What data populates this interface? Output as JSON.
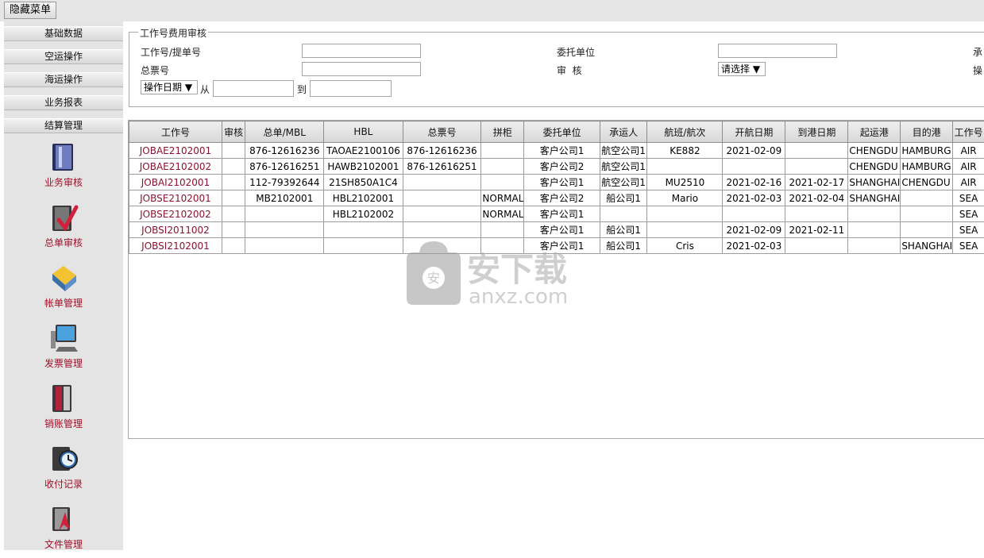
{
  "topbar": {
    "hide_menu_button": "隐藏菜单"
  },
  "sidebar": {
    "groups": [
      "基础数据",
      "空运操作",
      "海运操作",
      "业务报表",
      "结算管理"
    ],
    "items": [
      {
        "label": "业务审核",
        "icon": "book-icon"
      },
      {
        "label": "总单审核",
        "icon": "book-check-icon"
      },
      {
        "label": "帐单管理",
        "icon": "folder-icon"
      },
      {
        "label": "发票管理",
        "icon": "computer-icon"
      },
      {
        "label": "销账管理",
        "icon": "binder-icon"
      },
      {
        "label": "收付记录",
        "icon": "clock-icon"
      },
      {
        "label": "文件管理",
        "icon": "document-icon"
      }
    ]
  },
  "filter": {
    "legend": "工作号费用审核",
    "job_no_label": "工作号/提单号",
    "job_no_value": "",
    "client_label": "委托单位",
    "client_value": "",
    "carrier_label_partial": "承",
    "master_no_label": "总票号",
    "master_no_value": "",
    "audit_label": "审  核",
    "audit_select": "请选择 ▼",
    "operator_label_partial": "操",
    "date_type_select": "操作日期 ▼",
    "from_label": "从",
    "from_value": "",
    "to_label": "到",
    "to_value": ""
  },
  "table": {
    "columns": [
      "工作号",
      "审核",
      "总单/MBL",
      "HBL",
      "总票号",
      "拼柜",
      "委托单位",
      "承运人",
      "航班/航次",
      "开航日期",
      "到港日期",
      "起运港",
      "目的港",
      "工作号"
    ],
    "rows": [
      [
        "JOBAE2102001",
        "",
        "876-12616236",
        "TAOAE2100106",
        "876-12616236",
        "",
        "客户公司1",
        "航空公司1",
        "KE882",
        "2021-02-09",
        "",
        "CHENGDU",
        "HAMBURG",
        "AIR"
      ],
      [
        "JOBAE2102002",
        "",
        "876-12616251",
        "HAWB2102001",
        "876-12616251",
        "",
        "客户公司2",
        "航空公司1",
        "",
        "",
        "",
        "CHENGDU",
        "HAMBURG",
        "AIR"
      ],
      [
        "JOBAI2102001",
        "",
        "112-79392644",
        "21SH850A1C4",
        "",
        "",
        "客户公司1",
        "航空公司1",
        "MU2510",
        "2021-02-16",
        "2021-02-17",
        "SHANGHAI",
        "CHENGDU",
        "AIR"
      ],
      [
        "JOBSE2102001",
        "",
        "MB2102001",
        "HBL2102001",
        "",
        "NORMAL",
        "客户公司2",
        "船公司1",
        "Mario",
        "2021-02-03",
        "2021-02-04",
        "SHANGHAI",
        "",
        "SEA"
      ],
      [
        "JOBSE2102002",
        "",
        "",
        "HBL2102002",
        "",
        "NORMAL",
        "客户公司1",
        "",
        "",
        "",
        "",
        "",
        "",
        "SEA"
      ],
      [
        "JOBSI2011002",
        "",
        "",
        "",
        "",
        "",
        "客户公司1",
        "船公司1",
        "",
        "2021-02-09",
        "2021-02-11",
        "",
        "",
        "SEA"
      ],
      [
        "JOBSI2102001",
        "",
        "",
        "",
        "",
        "",
        "客户公司1",
        "船公司1",
        "Cris",
        "2021-02-03",
        "",
        "",
        "SHANGHAI",
        "SEA"
      ]
    ]
  },
  "watermark": {
    "text_cn": "安下载",
    "text_en": "anxz.com"
  }
}
